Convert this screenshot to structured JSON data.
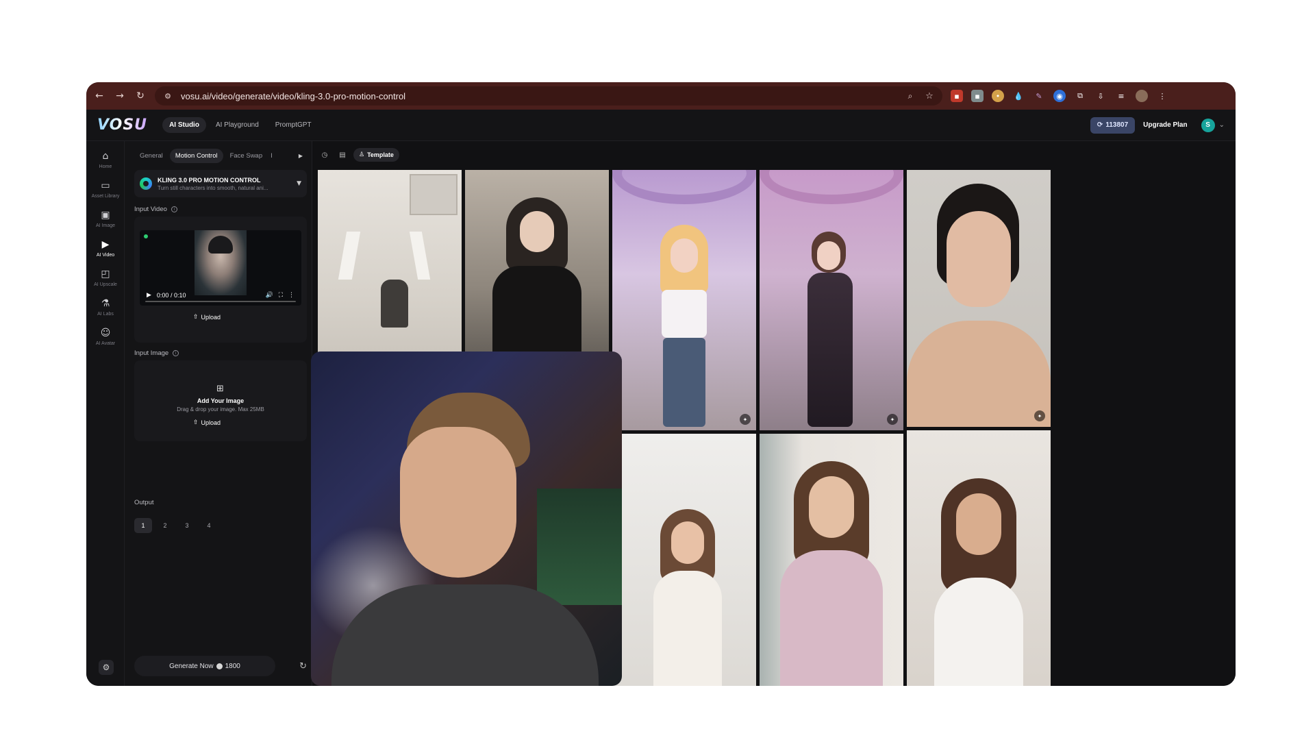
{
  "browser": {
    "url": "vosu.ai/video/generate/video/kling-3.0-pro-motion-control",
    "back_icon": "back-arrow-icon",
    "forward_icon": "forward-arrow-icon",
    "reload_icon": "reload-icon"
  },
  "header": {
    "logo": "VOSU",
    "tabs": [
      {
        "label": "AI Studio",
        "active": true
      },
      {
        "label": "AI Playground",
        "active": false
      },
      {
        "label": "PromptGPT",
        "active": false
      }
    ],
    "credits": "113807",
    "upgrade_label": "Upgrade Plan",
    "avatar_initial": "S"
  },
  "rail": {
    "items": [
      {
        "label": "Home",
        "icon": "home-icon"
      },
      {
        "label": "Asset Library",
        "icon": "folder-icon"
      },
      {
        "label": "AI Image",
        "icon": "image-icon"
      },
      {
        "label": "AI Video",
        "icon": "video-icon",
        "active": true
      },
      {
        "label": "AI Upscale",
        "icon": "upscale-icon"
      },
      {
        "label": "AI Labs",
        "icon": "flask-icon"
      },
      {
        "label": "AI Avatar",
        "icon": "avatar-icon"
      }
    ]
  },
  "panel": {
    "mode_tabs": [
      {
        "label": "General",
        "active": false
      },
      {
        "label": "Motion Control",
        "active": true
      },
      {
        "label": "Face Swap",
        "active": false
      },
      {
        "label": "I",
        "active": false
      }
    ],
    "model": {
      "name": "KLING 3.0 PRO MOTION CONTROL",
      "description": "Turn still characters into smooth, natural ani..."
    },
    "input_video_label": "Input Video",
    "video_time": "0:00 / 0:10",
    "upload_label": "Upload",
    "input_image_label": "Input Image",
    "add_image_title": "Add Your Image",
    "add_image_sub": "Drag & drop your image. Max 25MB",
    "upload_label_2": "Upload",
    "output_label": "Output",
    "output_options": [
      "1",
      "2",
      "3",
      "4"
    ],
    "output_selected": "1",
    "generate_label": "Generate Now",
    "generate_cost": "1800"
  },
  "gallery": {
    "template_label": "Template"
  },
  "colors": {
    "chrome": "#4a1f1c",
    "app_bg": "#111113",
    "credits_bg": "#3a4566",
    "avatar": "#17a39b",
    "accent_green": "#2ecc71"
  }
}
